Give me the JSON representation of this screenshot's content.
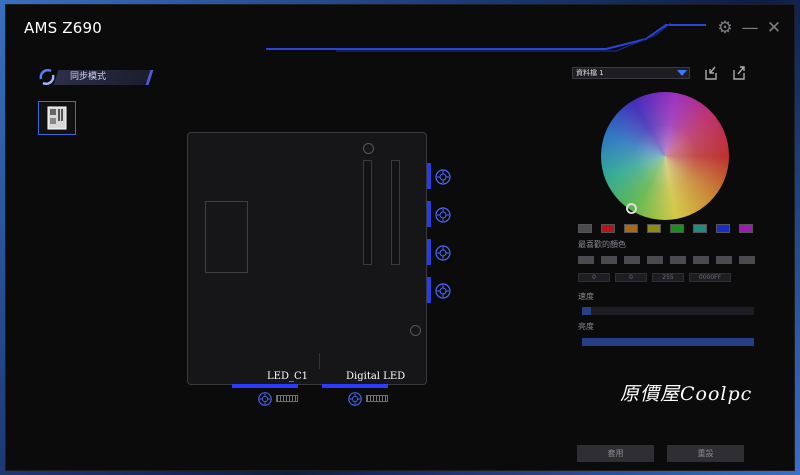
{
  "window": {
    "title": "AMS Z690"
  },
  "sync": {
    "label": "同步模式"
  },
  "board": {
    "header_left_label": "LED_C1",
    "header_right_label": "Digital LED"
  },
  "profile": {
    "selected": "資料檔 1"
  },
  "colors": {
    "accent": "#2340e8",
    "swatches": [
      "#4a4a4f",
      "#b01818",
      "#a86a18",
      "#8e8a18",
      "#1e8c1e",
      "#1e8c7e",
      "#1c2cc8",
      "#9a1cb0"
    ]
  },
  "labels": {
    "recent_colors": "最喜歡的顏色",
    "speed": "速度",
    "brightness": "亮度"
  },
  "values": {
    "r": "0",
    "g": "0",
    "b": "255",
    "hex": "0000FF"
  },
  "sliders": {
    "speed": 0.05,
    "brightness": 1.0
  },
  "watermark": "原價屋Coolpc",
  "buttons": {
    "apply": "套用",
    "reset": "重設"
  }
}
